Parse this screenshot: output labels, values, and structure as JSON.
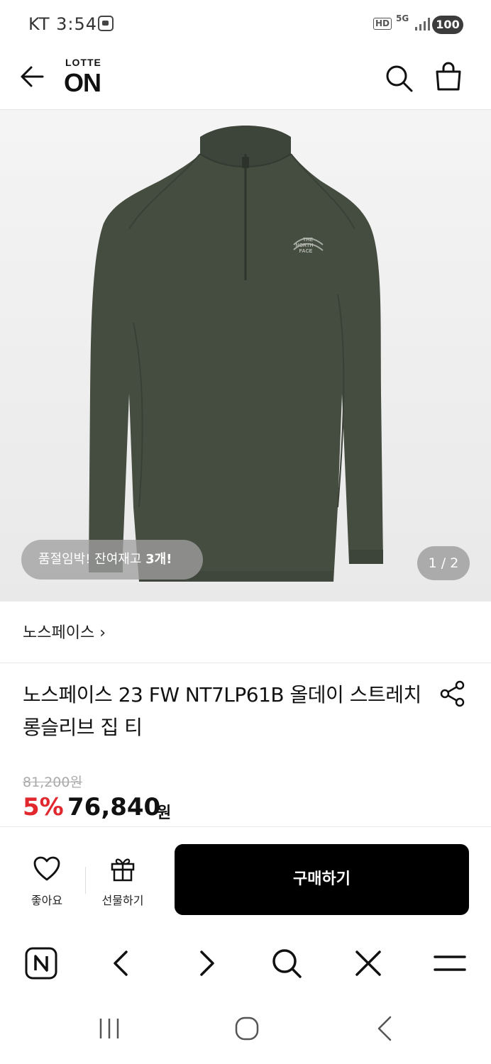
{
  "status_bar": {
    "carrier_time": "KT 3:54",
    "hd": "HD",
    "network": "5G",
    "battery": "100"
  },
  "header": {
    "logo_top": "LOTTE",
    "logo_bottom": "ON"
  },
  "product_image": {
    "logo_text": [
      "THE",
      "NORTH",
      "FACE"
    ],
    "stock_badge_prefix": "품절임박! 잔여재고 ",
    "stock_badge_count": "3개!",
    "page_counter": "1 / 2"
  },
  "brand": {
    "label": "노스페이스 ›"
  },
  "product": {
    "title": "노스페이스 23 FW NT7LP61B 올데이 스트레치 롱슬리브 집 티",
    "original_price": "81,200원",
    "discount": "5%",
    "sale_price": "76,840",
    "currency": "원"
  },
  "actions": {
    "like_label": "좋아요",
    "gift_label": "선물하기",
    "buy_label": "구매하기"
  },
  "colors": {
    "discount": "#e0282e",
    "shirt": "#454c40",
    "buy_button": "#000000"
  }
}
